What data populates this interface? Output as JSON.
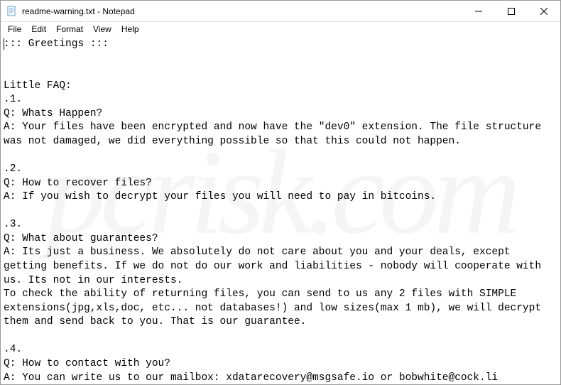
{
  "titlebar": {
    "title": "readme-warning.txt - Notepad"
  },
  "menubar": {
    "items": [
      "File",
      "Edit",
      "Format",
      "View",
      "Help"
    ]
  },
  "content": {
    "text": "::: Greetings :::\n\n\nLittle FAQ:\n.1.\nQ: Whats Happen?\nA: Your files have been encrypted and now have the \"dev0\" extension. The file structure was not damaged, we did everything possible so that this could not happen.\n\n.2.\nQ: How to recover files?\nA: If you wish to decrypt your files you will need to pay in bitcoins.\n\n.3.\nQ: What about guarantees?\nA: Its just a business. We absolutely do not care about you and your deals, except getting benefits. If we do not do our work and liabilities - nobody will cooperate with us. Its not in our interests.\nTo check the ability of returning files, you can send to us any 2 files with SIMPLE extensions(jpg,xls,doc, etc... not databases!) and low sizes(max 1 mb), we will decrypt them and send back to you. That is our guarantee.\n\n.4.\nQ: How to contact with you?\nA: You can write us to our mailbox: xdatarecovery@msgsafe.io or bobwhite@cock.li"
  },
  "watermark": {
    "text": "pcrisk.com"
  }
}
